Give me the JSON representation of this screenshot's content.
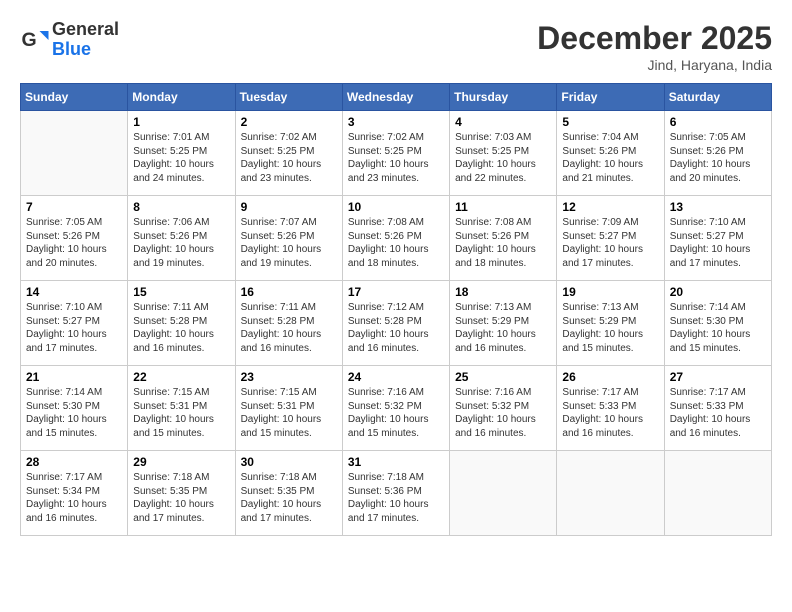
{
  "header": {
    "logo_general": "General",
    "logo_blue": "Blue",
    "title": "December 2025",
    "location": "Jind, Haryana, India"
  },
  "weekdays": [
    "Sunday",
    "Monday",
    "Tuesday",
    "Wednesday",
    "Thursday",
    "Friday",
    "Saturday"
  ],
  "weeks": [
    [
      {
        "day": "",
        "info": ""
      },
      {
        "day": "1",
        "info": "Sunrise: 7:01 AM\nSunset: 5:25 PM\nDaylight: 10 hours\nand 24 minutes."
      },
      {
        "day": "2",
        "info": "Sunrise: 7:02 AM\nSunset: 5:25 PM\nDaylight: 10 hours\nand 23 minutes."
      },
      {
        "day": "3",
        "info": "Sunrise: 7:02 AM\nSunset: 5:25 PM\nDaylight: 10 hours\nand 23 minutes."
      },
      {
        "day": "4",
        "info": "Sunrise: 7:03 AM\nSunset: 5:25 PM\nDaylight: 10 hours\nand 22 minutes."
      },
      {
        "day": "5",
        "info": "Sunrise: 7:04 AM\nSunset: 5:26 PM\nDaylight: 10 hours\nand 21 minutes."
      },
      {
        "day": "6",
        "info": "Sunrise: 7:05 AM\nSunset: 5:26 PM\nDaylight: 10 hours\nand 20 minutes."
      }
    ],
    [
      {
        "day": "7",
        "info": "Sunrise: 7:05 AM\nSunset: 5:26 PM\nDaylight: 10 hours\nand 20 minutes."
      },
      {
        "day": "8",
        "info": "Sunrise: 7:06 AM\nSunset: 5:26 PM\nDaylight: 10 hours\nand 19 minutes."
      },
      {
        "day": "9",
        "info": "Sunrise: 7:07 AM\nSunset: 5:26 PM\nDaylight: 10 hours\nand 19 minutes."
      },
      {
        "day": "10",
        "info": "Sunrise: 7:08 AM\nSunset: 5:26 PM\nDaylight: 10 hours\nand 18 minutes."
      },
      {
        "day": "11",
        "info": "Sunrise: 7:08 AM\nSunset: 5:26 PM\nDaylight: 10 hours\nand 18 minutes."
      },
      {
        "day": "12",
        "info": "Sunrise: 7:09 AM\nSunset: 5:27 PM\nDaylight: 10 hours\nand 17 minutes."
      },
      {
        "day": "13",
        "info": "Sunrise: 7:10 AM\nSunset: 5:27 PM\nDaylight: 10 hours\nand 17 minutes."
      }
    ],
    [
      {
        "day": "14",
        "info": "Sunrise: 7:10 AM\nSunset: 5:27 PM\nDaylight: 10 hours\nand 17 minutes."
      },
      {
        "day": "15",
        "info": "Sunrise: 7:11 AM\nSunset: 5:28 PM\nDaylight: 10 hours\nand 16 minutes."
      },
      {
        "day": "16",
        "info": "Sunrise: 7:11 AM\nSunset: 5:28 PM\nDaylight: 10 hours\nand 16 minutes."
      },
      {
        "day": "17",
        "info": "Sunrise: 7:12 AM\nSunset: 5:28 PM\nDaylight: 10 hours\nand 16 minutes."
      },
      {
        "day": "18",
        "info": "Sunrise: 7:13 AM\nSunset: 5:29 PM\nDaylight: 10 hours\nand 16 minutes."
      },
      {
        "day": "19",
        "info": "Sunrise: 7:13 AM\nSunset: 5:29 PM\nDaylight: 10 hours\nand 15 minutes."
      },
      {
        "day": "20",
        "info": "Sunrise: 7:14 AM\nSunset: 5:30 PM\nDaylight: 10 hours\nand 15 minutes."
      }
    ],
    [
      {
        "day": "21",
        "info": "Sunrise: 7:14 AM\nSunset: 5:30 PM\nDaylight: 10 hours\nand 15 minutes."
      },
      {
        "day": "22",
        "info": "Sunrise: 7:15 AM\nSunset: 5:31 PM\nDaylight: 10 hours\nand 15 minutes."
      },
      {
        "day": "23",
        "info": "Sunrise: 7:15 AM\nSunset: 5:31 PM\nDaylight: 10 hours\nand 15 minutes."
      },
      {
        "day": "24",
        "info": "Sunrise: 7:16 AM\nSunset: 5:32 PM\nDaylight: 10 hours\nand 15 minutes."
      },
      {
        "day": "25",
        "info": "Sunrise: 7:16 AM\nSunset: 5:32 PM\nDaylight: 10 hours\nand 16 minutes."
      },
      {
        "day": "26",
        "info": "Sunrise: 7:17 AM\nSunset: 5:33 PM\nDaylight: 10 hours\nand 16 minutes."
      },
      {
        "day": "27",
        "info": "Sunrise: 7:17 AM\nSunset: 5:33 PM\nDaylight: 10 hours\nand 16 minutes."
      }
    ],
    [
      {
        "day": "28",
        "info": "Sunrise: 7:17 AM\nSunset: 5:34 PM\nDaylight: 10 hours\nand 16 minutes."
      },
      {
        "day": "29",
        "info": "Sunrise: 7:18 AM\nSunset: 5:35 PM\nDaylight: 10 hours\nand 17 minutes."
      },
      {
        "day": "30",
        "info": "Sunrise: 7:18 AM\nSunset: 5:35 PM\nDaylight: 10 hours\nand 17 minutes."
      },
      {
        "day": "31",
        "info": "Sunrise: 7:18 AM\nSunset: 5:36 PM\nDaylight: 10 hours\nand 17 minutes."
      },
      {
        "day": "",
        "info": ""
      },
      {
        "day": "",
        "info": ""
      },
      {
        "day": "",
        "info": ""
      }
    ]
  ]
}
